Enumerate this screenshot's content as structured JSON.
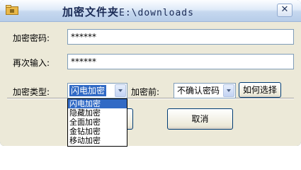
{
  "window": {
    "title": "加密文件夹",
    "path": "E:\\downloads",
    "close_glyph": "✕"
  },
  "form": {
    "password_label": "加密密码:",
    "password_value": "******",
    "confirm_label": "再次输入:",
    "confirm_value": "******",
    "type_label": "加密类型:",
    "type_selected": "闪电加密",
    "before_label": "加密前:",
    "before_selected": "不确认密码",
    "help_button": "如何选择"
  },
  "buttons": {
    "cancel": "取消"
  },
  "dropdown": {
    "options": [
      "闪电加密",
      "隐藏加密",
      "全面加密",
      "金钻加密",
      "移动加密"
    ],
    "selected_index": 0
  },
  "colors": {
    "selection": "#316ac5",
    "dialog_bg": "#ece9d8"
  }
}
